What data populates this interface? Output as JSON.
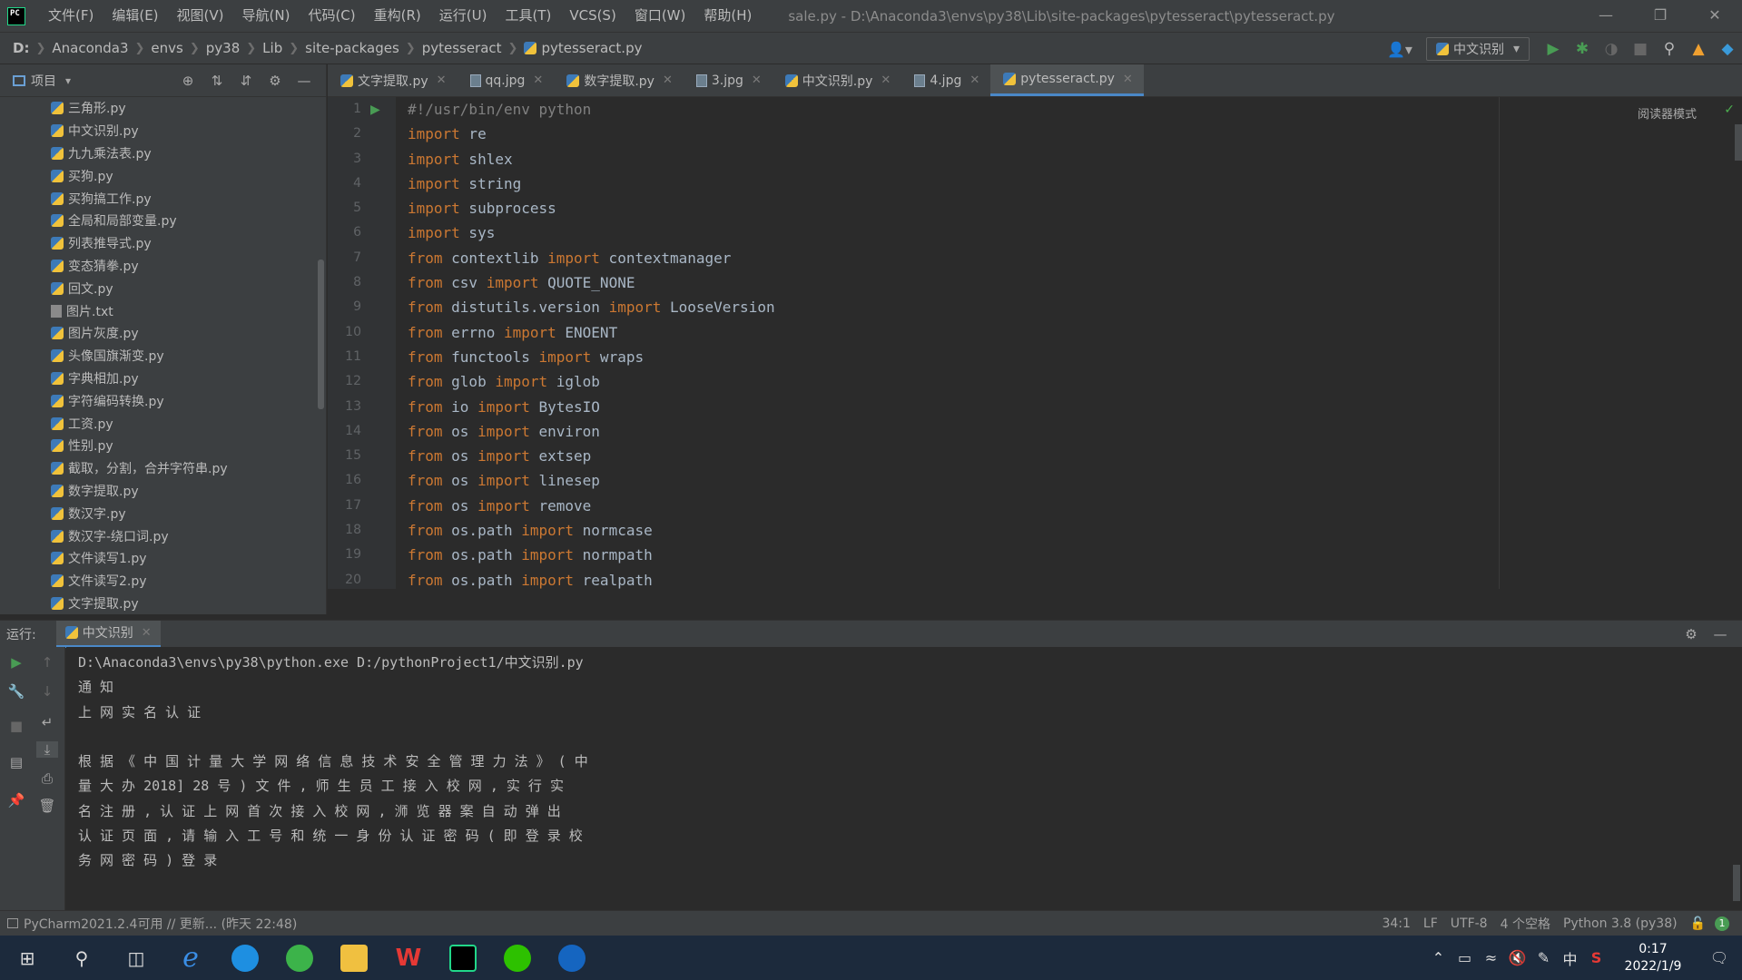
{
  "titlebar": {
    "menu": [
      "文件(F)",
      "编辑(E)",
      "视图(V)",
      "导航(N)",
      "代码(C)",
      "重构(R)",
      "运行(U)",
      "工具(T)",
      "VCS(S)",
      "窗口(W)",
      "帮助(H)"
    ],
    "window_title": "sale.py - D:\\Anaconda3\\envs\\py38\\Lib\\site-packages\\pytesseract\\pytesseract.py"
  },
  "breadcrumb": [
    "D:",
    "Anaconda3",
    "envs",
    "py38",
    "Lib",
    "site-packages",
    "pytesseract",
    "pytesseract.py"
  ],
  "run_config": {
    "label": "中文识别"
  },
  "project_panel": {
    "title": "项目",
    "files": [
      {
        "name": "三角形.py",
        "type": "py"
      },
      {
        "name": "中文识别.py",
        "type": "py"
      },
      {
        "name": "九九乘法表.py",
        "type": "py"
      },
      {
        "name": "买狗.py",
        "type": "py"
      },
      {
        "name": "买狗搞工作.py",
        "type": "py"
      },
      {
        "name": "全局和局部变量.py",
        "type": "py"
      },
      {
        "name": "列表推导式.py",
        "type": "py"
      },
      {
        "name": "变态猜拳.py",
        "type": "py"
      },
      {
        "name": "回文.py",
        "type": "py"
      },
      {
        "name": "图片.txt",
        "type": "txt"
      },
      {
        "name": "图片灰度.py",
        "type": "py"
      },
      {
        "name": "头像国旗渐变.py",
        "type": "py"
      },
      {
        "name": "字典相加.py",
        "type": "py"
      },
      {
        "name": "字符编码转换.py",
        "type": "py"
      },
      {
        "name": "工资.py",
        "type": "py"
      },
      {
        "name": "性别.py",
        "type": "py"
      },
      {
        "name": "截取，分割，合并字符串.py",
        "type": "py"
      },
      {
        "name": "数字提取.py",
        "type": "py"
      },
      {
        "name": "数汉字.py",
        "type": "py"
      },
      {
        "name": "数汉字-绕口词.py",
        "type": "py"
      },
      {
        "name": "文件读写1.py",
        "type": "py"
      },
      {
        "name": "文件读写2.py",
        "type": "py"
      },
      {
        "name": "文字提取.py",
        "type": "py"
      }
    ]
  },
  "editor_tabs": [
    {
      "label": "文字提取.py",
      "type": "py",
      "active": false
    },
    {
      "label": "qq.jpg",
      "type": "img",
      "active": false
    },
    {
      "label": "数字提取.py",
      "type": "py",
      "active": false
    },
    {
      "label": "3.jpg",
      "type": "img",
      "active": false
    },
    {
      "label": "中文识别.py",
      "type": "py",
      "active": false
    },
    {
      "label": "4.jpg",
      "type": "img",
      "active": false
    },
    {
      "label": "pytesseract.py",
      "type": "py",
      "active": true
    }
  ],
  "editor": {
    "reader_mode": "阅读器模式",
    "lines": [
      [
        {
          "t": "#!/usr/bin/env python",
          "c": "cmt"
        }
      ],
      [
        {
          "t": "import",
          "c": "kw"
        },
        {
          "t": " re",
          "c": ""
        }
      ],
      [
        {
          "t": "import",
          "c": "kw"
        },
        {
          "t": " shlex",
          "c": ""
        }
      ],
      [
        {
          "t": "import",
          "c": "kw"
        },
        {
          "t": " string",
          "c": ""
        }
      ],
      [
        {
          "t": "import",
          "c": "kw"
        },
        {
          "t": " subprocess",
          "c": ""
        }
      ],
      [
        {
          "t": "import",
          "c": "kw"
        },
        {
          "t": " sys",
          "c": ""
        }
      ],
      [
        {
          "t": "from",
          "c": "kw"
        },
        {
          "t": " contextlib ",
          "c": ""
        },
        {
          "t": "import",
          "c": "kw"
        },
        {
          "t": " contextmanager",
          "c": ""
        }
      ],
      [
        {
          "t": "from",
          "c": "kw"
        },
        {
          "t": " csv ",
          "c": ""
        },
        {
          "t": "import",
          "c": "kw"
        },
        {
          "t": " QUOTE_NONE",
          "c": ""
        }
      ],
      [
        {
          "t": "from",
          "c": "kw"
        },
        {
          "t": " distutils.version ",
          "c": ""
        },
        {
          "t": "import",
          "c": "kw"
        },
        {
          "t": " LooseVersion",
          "c": ""
        }
      ],
      [
        {
          "t": "from",
          "c": "kw"
        },
        {
          "t": " errno ",
          "c": ""
        },
        {
          "t": "import",
          "c": "kw"
        },
        {
          "t": " ENOENT",
          "c": ""
        }
      ],
      [
        {
          "t": "from",
          "c": "kw"
        },
        {
          "t": " functools ",
          "c": ""
        },
        {
          "t": "import",
          "c": "kw"
        },
        {
          "t": " wraps",
          "c": ""
        }
      ],
      [
        {
          "t": "from",
          "c": "kw"
        },
        {
          "t": " glob ",
          "c": ""
        },
        {
          "t": "import",
          "c": "kw"
        },
        {
          "t": " iglob",
          "c": ""
        }
      ],
      [
        {
          "t": "from",
          "c": "kw"
        },
        {
          "t": " io ",
          "c": ""
        },
        {
          "t": "import",
          "c": "kw"
        },
        {
          "t": " BytesIO",
          "c": ""
        }
      ],
      [
        {
          "t": "from",
          "c": "kw"
        },
        {
          "t": " os ",
          "c": ""
        },
        {
          "t": "import",
          "c": "kw"
        },
        {
          "t": " environ",
          "c": ""
        }
      ],
      [
        {
          "t": "from",
          "c": "kw"
        },
        {
          "t": " os ",
          "c": ""
        },
        {
          "t": "import",
          "c": "kw"
        },
        {
          "t": " extsep",
          "c": ""
        }
      ],
      [
        {
          "t": "from",
          "c": "kw"
        },
        {
          "t": " os ",
          "c": ""
        },
        {
          "t": "import",
          "c": "kw"
        },
        {
          "t": " linesep",
          "c": ""
        }
      ],
      [
        {
          "t": "from",
          "c": "kw"
        },
        {
          "t": " os ",
          "c": ""
        },
        {
          "t": "import",
          "c": "kw"
        },
        {
          "t": " remove",
          "c": ""
        }
      ],
      [
        {
          "t": "from",
          "c": "kw"
        },
        {
          "t": " os.path ",
          "c": ""
        },
        {
          "t": "import",
          "c": "kw"
        },
        {
          "t": " normcase",
          "c": ""
        }
      ],
      [
        {
          "t": "from",
          "c": "kw"
        },
        {
          "t": " os.path ",
          "c": ""
        },
        {
          "t": "import",
          "c": "kw"
        },
        {
          "t": " normpath",
          "c": ""
        }
      ],
      [
        {
          "t": "from",
          "c": "kw"
        },
        {
          "t": " os.path ",
          "c": ""
        },
        {
          "t": "import",
          "c": "kw"
        },
        {
          "t": " realpath",
          "c": ""
        }
      ]
    ]
  },
  "run_panel": {
    "label": "运行:",
    "tab": "中文识别",
    "output": [
      "D:\\Anaconda3\\envs\\py38\\python.exe D:/pythonProject1/中文识别.py",
      "通 知",
      "上 网 实 名 认 证",
      "",
      "根 据 《 中 国 计 量 大 学 网 络 信 息 技 术 安 全 管 理 力 法 》 ( 中",
      "量 大 办 2018] 28 号 ) 文 件 , 师 生 员 工 接 入 校 网 , 实 行 实",
      "名 注 册 , 认 证 上 网 首 次 接 入 校 网 , 浉 览 器 案 自 动 弹 出",
      "认 证 页 面 , 请 输 入 工 号 和 统 一 身 份 认 证 密 码 ( 即 登 录 校",
      "务 网 密 码 ) 登 录",
      "\f"
    ]
  },
  "statusbar": {
    "message": "PyCharm2021.2.4可用 // 更新... (昨天 22:48)",
    "position": "34:1",
    "line_sep": "LF",
    "encoding": "UTF-8",
    "indent": "4 个空格",
    "interpreter": "Python 3.8 (py38)",
    "notifications": "1"
  },
  "taskbar": {
    "time": "0:17",
    "date": "2022/1/9",
    "input_method": "中"
  },
  "colors": {
    "keyword": "#cc7832",
    "comment": "#808080",
    "accent": "#4a88c7",
    "run_green": "#499c54"
  }
}
